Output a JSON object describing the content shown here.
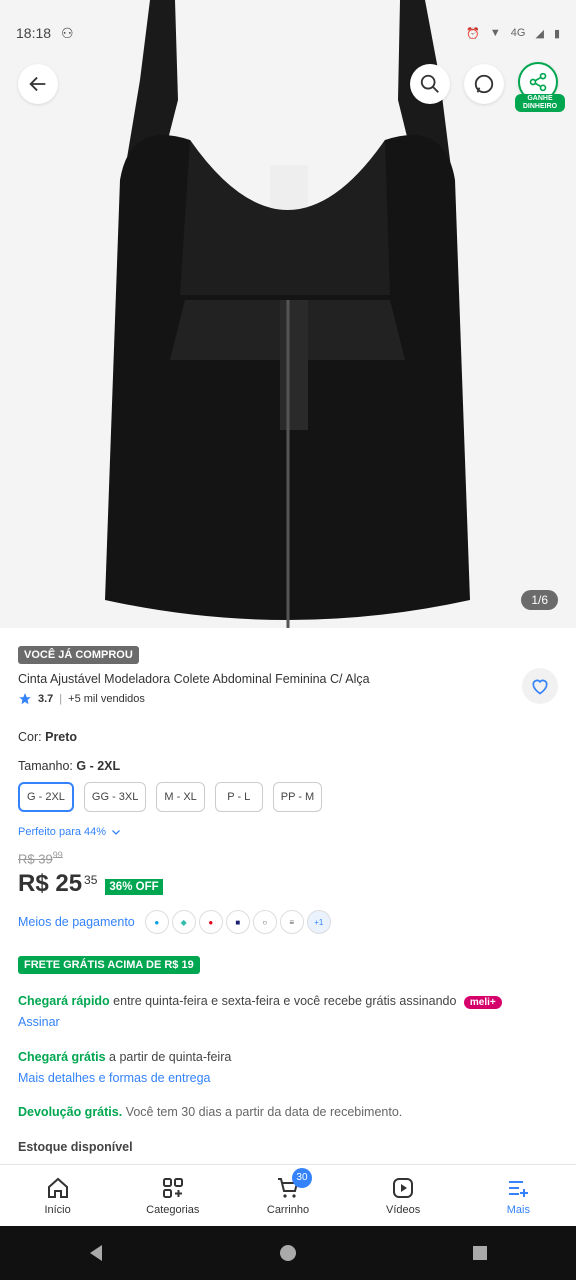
{
  "status": {
    "time": "18:18",
    "network": "4G"
  },
  "gallery": {
    "counter": "1/6"
  },
  "topbar": {
    "share_badge": "GANHE DINHEIRO"
  },
  "product": {
    "badge": "VOCÊ JÁ COMPROU",
    "title": "Cinta Ajustável Modeladora Colete Abdominal Feminina C/ Alça",
    "rating": "3.7",
    "sold": "+5 mil vendidos"
  },
  "variants": {
    "color_label": "Cor:",
    "color_value": "Preto",
    "size_label": "Tamanho:",
    "size_value": "G - 2XL",
    "sizes": [
      "G - 2XL",
      "GG - 3XL",
      "M - XL",
      "P - L",
      "PP - M"
    ],
    "perfect_for": "Perfeito para 44%"
  },
  "pricing": {
    "old_price": "R$ 39",
    "old_cents": "99",
    "price": "R$ 25",
    "cents": "35",
    "discount": "36% OFF"
  },
  "payment": {
    "label": "Meios de pagamento",
    "more": "+1",
    "icons": [
      "mercado-pago-icon",
      "pix-icon",
      "mastercard-icon",
      "visa-icon",
      "elo-icon",
      "boleto-icon"
    ]
  },
  "shipping": {
    "banner": "FRETE GRÁTIS ACIMA DE R$ 19",
    "fast_green": "Chegará rápido",
    "fast_text": "entre quinta-feira e sexta-feira e você recebe grátis assinando",
    "meli": "meli+",
    "subscribe": "Assinar",
    "free_green": "Chegará grátis",
    "free_text": "a partir de quinta-feira",
    "details": "Mais detalhes e formas de entrega",
    "return_green": "Devolução grátis.",
    "return_text": "Você tem 30 dias a partir da data de recebimento.",
    "stock": "Estoque disponível"
  },
  "nav": {
    "items": [
      "Início",
      "Categorias",
      "Carrinho",
      "Vídeos",
      "Mais"
    ],
    "cart_count": "30"
  },
  "colors": {
    "accent": "#3483fa",
    "green": "#00a650",
    "meli": "#d6006b"
  }
}
